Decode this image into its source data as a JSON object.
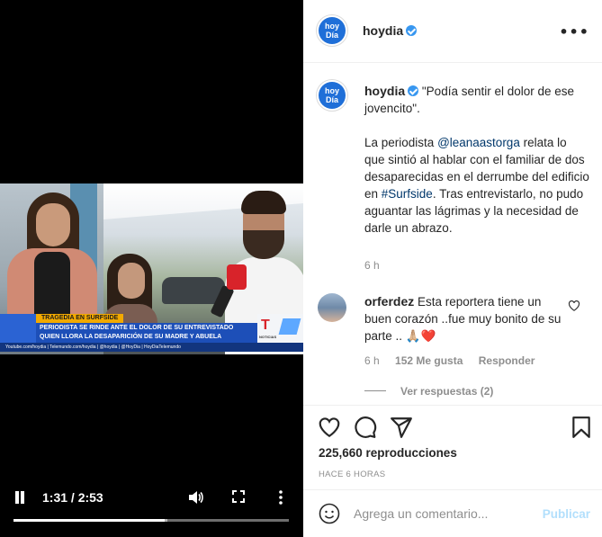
{
  "video": {
    "ticker_tag": "TRAGEDIA EN SURFSIDE",
    "ticker_line1": "PERIODISTA SE RINDE ANTE EL DOLOR DE SU ENTREVISTADO",
    "ticker_line2": "QUIEN LLORA LA DESAPARICIÓN DE SU MADRE Y ABUELA",
    "socials": "Youtube.com/hoydia  |  Telemundo.com/hoydia  |  @hoydia  |  @HoyDia  |  HoyDiaTelemundo",
    "channel_logo": "T",
    "channel_tag": "NOTICIAS",
    "time": "1:31 / 2:53",
    "progress_fraction": 0.55,
    "buffered_fraction": 0.56
  },
  "header": {
    "username": "hoydia",
    "avatar_text_1": "hoy",
    "avatar_text_2": "Día"
  },
  "caption": {
    "username": "hoydia",
    "quote": "\"Podía sentir el dolor de ese jovencito\".",
    "body_before": "La periodista ",
    "mention": "@leanaastorga",
    "body_mid": " relata lo que sintió al hablar con el familiar de dos desaparecidas en el derrumbe del edificio en ",
    "hashtag": "#Surfside",
    "body_after": ". Tras entrevistarlo, no pudo aguantar las lágrimas y la necesidad de darle un abrazo.",
    "time": "6 h"
  },
  "comment": {
    "username": "orferdez",
    "text": "Esta reportera tiene un buen corazón ..fue muy bonito de su parte .. 🙏🏼❤️",
    "time": "6 h",
    "likes": "152 Me gusta",
    "reply": "Responder",
    "view_replies": "Ver respuestas (2)"
  },
  "stats": {
    "views": "225,660 reproducciones",
    "ago": "HACE 6 HORAS"
  },
  "composer": {
    "placeholder": "Agrega un comentario...",
    "publish": "Publicar"
  },
  "colors": {
    "link": "#00376b",
    "publish_disabled": "#b2dffc",
    "brand_blue": "#1f6fd8"
  }
}
